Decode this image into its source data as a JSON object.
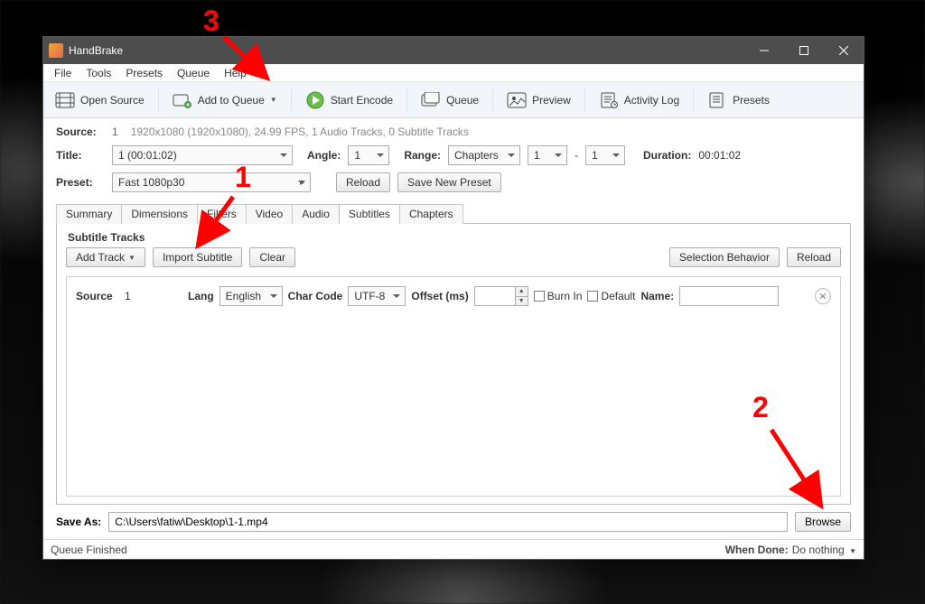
{
  "window": {
    "title": "HandBrake"
  },
  "menu": {
    "file": "File",
    "tools": "Tools",
    "presets": "Presets",
    "queue": "Queue",
    "help": "Help"
  },
  "toolbar": {
    "open_source": "Open Source",
    "add_to_queue": "Add to Queue",
    "start_encode": "Start Encode",
    "queue": "Queue",
    "preview": "Preview",
    "activity_log": "Activity Log",
    "presets": "Presets"
  },
  "source": {
    "label": "Source:",
    "index": "1",
    "details": "1920x1080 (1920x1080), 24.99 FPS, 1 Audio Tracks, 0 Subtitle Tracks"
  },
  "title": {
    "label": "Title:",
    "value": "1  (00:01:02)",
    "angle_label": "Angle:",
    "angle_value": "1",
    "range_label": "Range:",
    "range_type": "Chapters",
    "range_from": "1",
    "range_sep": "-",
    "range_to": "1",
    "duration_label": "Duration:",
    "duration_value": "00:01:02"
  },
  "preset": {
    "label": "Preset:",
    "value": "Fast 1080p30",
    "reload": "Reload",
    "save_new": "Save New Preset"
  },
  "tabs": {
    "summary": "Summary",
    "dimensions": "Dimensions",
    "filters": "Filters",
    "video": "Video",
    "audio": "Audio",
    "subtitles": "Subtitles",
    "chapters": "Chapters"
  },
  "subtitles": {
    "heading": "Subtitle Tracks",
    "add_track": "Add Track",
    "import_subtitle": "Import Subtitle",
    "clear": "Clear",
    "selection_behavior": "Selection Behavior",
    "reload": "Reload",
    "track": {
      "source_label": "Source",
      "source_value": "1",
      "lang_label": "Lang",
      "lang_value": "English",
      "charcode_label": "Char Code",
      "charcode_value": "UTF-8",
      "offset_label": "Offset (ms)",
      "offset_value": "",
      "burnin_label": "Burn In",
      "default_label": "Default",
      "name_label": "Name:",
      "name_value": ""
    }
  },
  "saveas": {
    "label": "Save As:",
    "path": "C:\\Users\\fatiw\\Desktop\\1-1.mp4",
    "browse": "Browse"
  },
  "status": {
    "left": "Queue Finished",
    "when_done_label": "When Done:",
    "when_done_value": "Do nothing"
  },
  "annotations": {
    "one": "1",
    "two": "2",
    "three": "3"
  }
}
